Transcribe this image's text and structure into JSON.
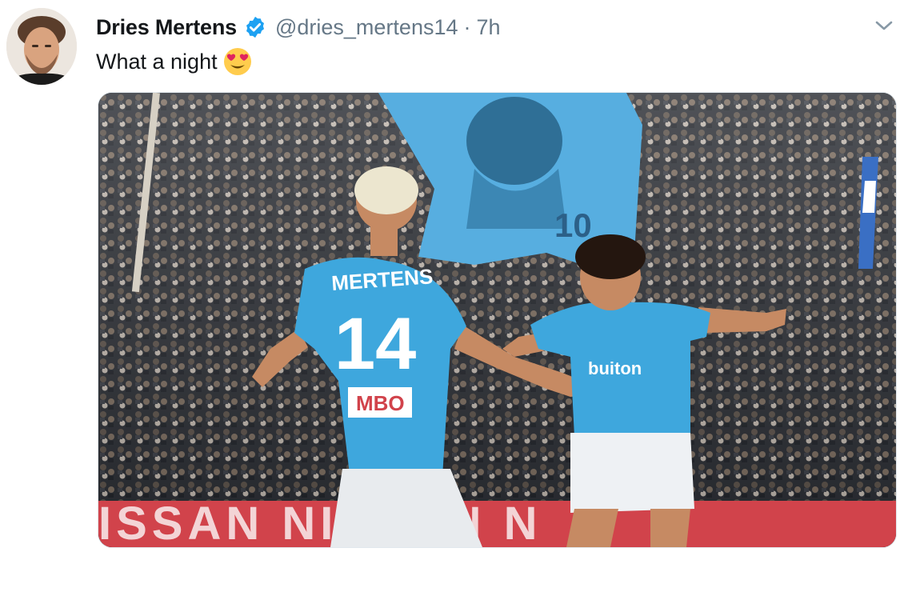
{
  "tweet": {
    "author": {
      "display_name": "Dries Mertens",
      "handle": "@dries_mertens14",
      "verified": true
    },
    "separator": "·",
    "time": "7h",
    "text": "What a night",
    "emoji": "heart-eyes-emoji",
    "menu_icon": "chevron-down-icon",
    "media": {
      "description_icon": "photo",
      "jersey_name": "MERTENS",
      "jersey_number": "14",
      "sponsor_left": "MBO",
      "sponsor_right": "buiton",
      "board_text": "ISSAN   NISSAN   N",
      "flag_number": "10"
    }
  },
  "colors": {
    "name_text": "#14171a",
    "secondary_text": "#657786",
    "verified_blue": "#1da1f2",
    "napoli_blue": "#3ea7dd"
  }
}
